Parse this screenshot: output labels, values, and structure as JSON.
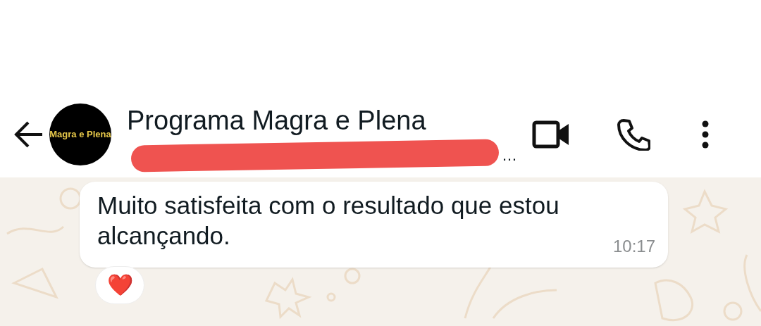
{
  "header": {
    "avatar_text": "Magra e Plena",
    "title": "Programa Magra e Plena",
    "subtitle": "…"
  },
  "messages": [
    {
      "text": "Muito satisfeita com o resultado que estou alcançando.",
      "time": "10:17",
      "reaction": "❤️"
    }
  ]
}
